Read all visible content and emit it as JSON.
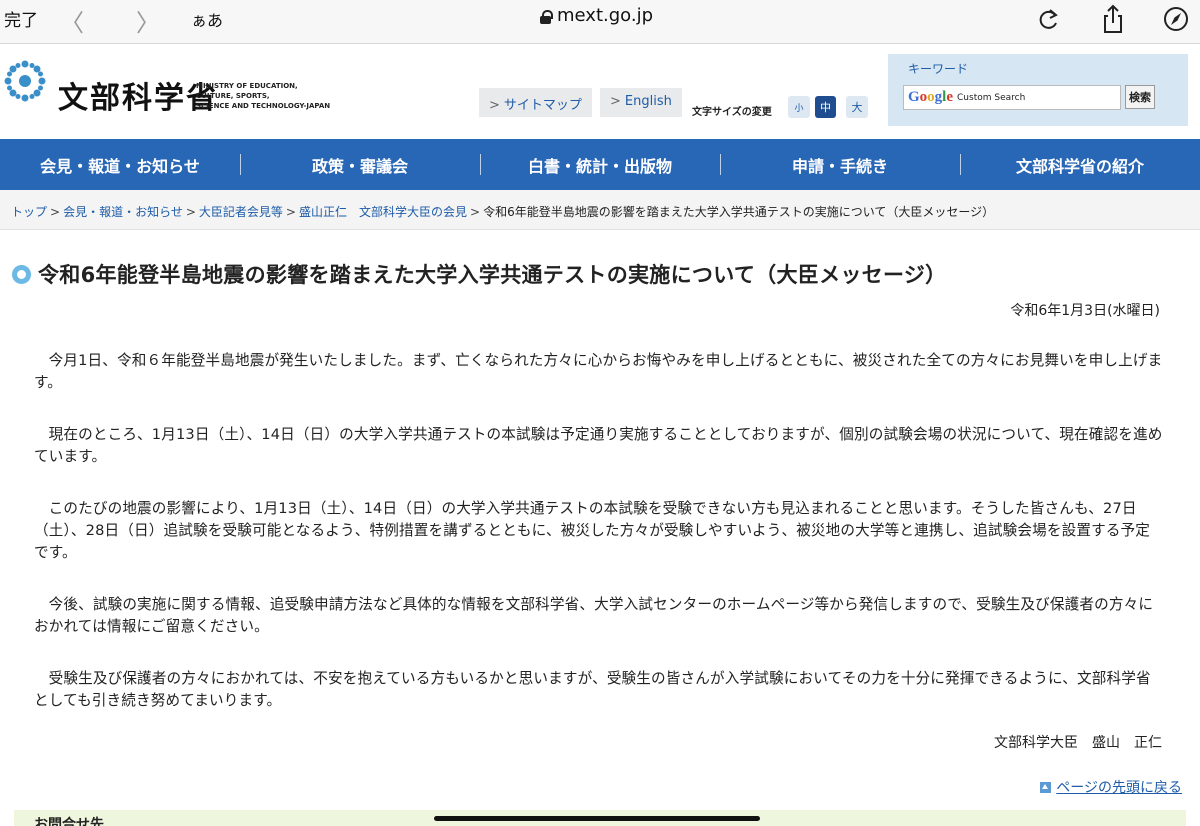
{
  "browser": {
    "done_label": "完了",
    "aa_label": "ぁあ",
    "url": "mext.go.jp",
    "icons": [
      "chevron-left-icon",
      "chevron-right-icon",
      "lock-icon",
      "reload-icon",
      "share-icon",
      "compass-icon"
    ]
  },
  "header": {
    "logo_text": "文部科学省",
    "logo_en_lines": [
      "MINISTRY OF EDUCATION,",
      "CULTURE, SPORTS,",
      "SCIENCE AND TECHNOLOGY-JAPAN"
    ],
    "sitemap_label": "サイトマップ",
    "english_label": "English",
    "font_size_label": "文字サイズの変更",
    "font_small": "小",
    "font_mid": "中",
    "font_large": "大",
    "keyword_label": "キーワード",
    "google_text": "Google",
    "custom_search_text": "Custom Search",
    "search_button": "検索"
  },
  "nav": {
    "items": [
      "会見・報道・お知らせ",
      "政策・審議会",
      "白書・統計・出版物",
      "申請・手続き",
      "文部科学省の紹介"
    ]
  },
  "breadcrumb": {
    "items": [
      "トップ",
      "会見・報道・お知らせ",
      "大臣記者会見等",
      "盛山正仁　文部科学大臣の会見"
    ],
    "current": "令和6年能登半島地震の影響を踏まえた大学入学共通テストの実施について（大臣メッセージ）",
    "separator": ">"
  },
  "article": {
    "title": "令和6年能登半島地震の影響を踏まえた大学入学共通テストの実施について（大臣メッセージ）",
    "date": "令和6年1月3日(水曜日)",
    "paragraphs": [
      "今月1日、令和６年能登半島地震が発生いたしました。まず、亡くなられた方々に心からお悔やみを申し上げるとともに、被災された全ての方々にお見舞いを申し上げます。",
      "現在のところ、1月13日（土）、14日（日）の大学入学共通テストの本試験は予定通り実施することとしておりますが、個別の試験会場の状況について、現在確認を進めています。",
      "このたびの地震の影響により、1月13日（土）、14日（日）の大学入学共通テストの本試験を受験できない方も見込まれることと思います。そうした皆さんも、27日（土）、28日（日）追試験を受験可能となるよう、特例措置を講ずるとともに、被災した方々が受験しやすいよう、被災地の大学等と連携し、追試験会場を設置する予定です。",
      "今後、試験の実施に関する情報、追受験申請方法など具体的な情報を文部科学省、大学入試センターのホームページ等から発信しますので、受験生及び保護者の方々におかれては情報にご留意ください。",
      "受験生及び保護者の方々におかれては、不安を抱えている方もいるかと思いますが、受験生の皆さんが入学試験においてその力を十分に発揮できるように、文部科学省としても引き続き努めてまいります。"
    ],
    "signature": "文部科学大臣　盛山　正仁",
    "back_to_top": "ページの先頭に戻る"
  },
  "footer": {
    "contact_heading": "お問合せ先"
  },
  "colors": {
    "nav_blue": "#2866b6",
    "link_blue": "#1e5ca8",
    "title_mark": "#6bb9e4"
  }
}
